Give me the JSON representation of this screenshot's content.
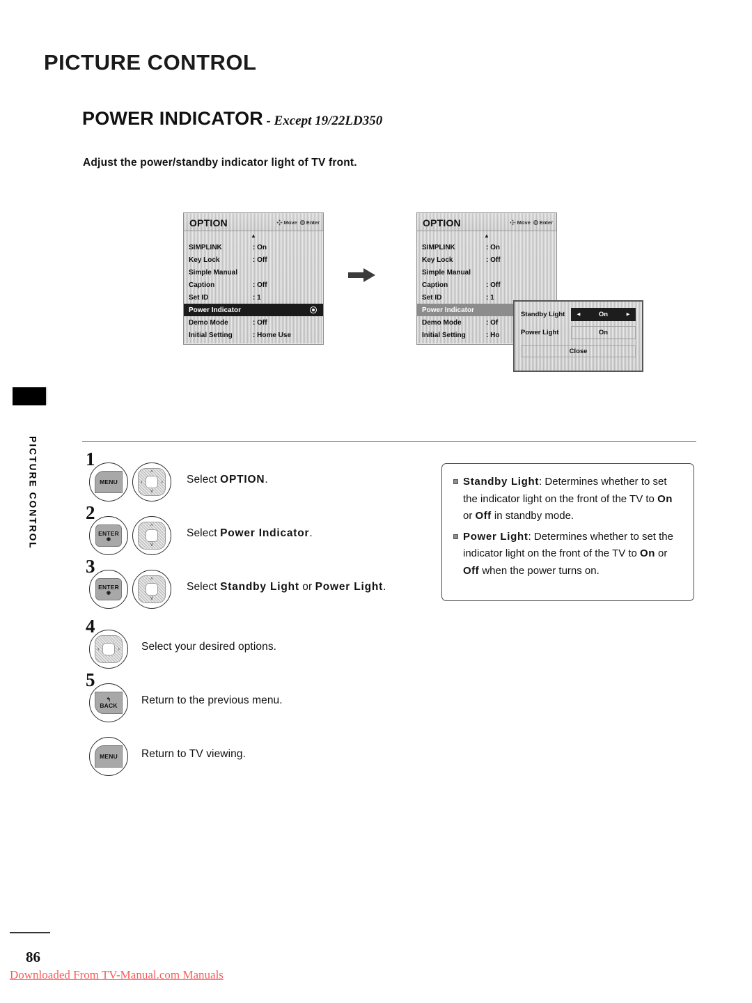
{
  "page": {
    "chapter_title": "PICTURE CONTROL",
    "section_title": "POWER INDICATOR",
    "section_subtitle": "- Except 19/22LD350",
    "lede": "Adjust the power/standby indicator light of TV front.",
    "side_tab_text": "PICTURE CONTROL",
    "page_number": "86",
    "download_note": "Downloaded From TV-Manual.com Manuals"
  },
  "osd": {
    "title": "OPTION",
    "hints": [
      {
        "icon": "dpad-move-icon",
        "label": "Move"
      },
      {
        "icon": "enter-dot-icon",
        "label": "Enter"
      }
    ],
    "scroll_up_glyph": "▲",
    "rows": [
      {
        "label": "SIMPLINK",
        "value": ": On"
      },
      {
        "label": "Key Lock",
        "value": ": Off"
      },
      {
        "label": "Simple Manual",
        "value": ""
      },
      {
        "label": "Caption",
        "value": ": Off"
      },
      {
        "label": "Set ID",
        "value": ": 1"
      },
      {
        "label": "Power Indicator",
        "value": ""
      },
      {
        "label": "Demo Mode",
        "value": ": Off"
      },
      {
        "label": "Initial Setting",
        "value": ": Home Use"
      }
    ],
    "rows_panel2": [
      {
        "label": "SIMPLINK",
        "value": ": On"
      },
      {
        "label": "Key Lock",
        "value": ": Off"
      },
      {
        "label": "Simple Manual",
        "value": ""
      },
      {
        "label": "Caption",
        "value": ": Off"
      },
      {
        "label": "Set ID",
        "value": ": 1"
      },
      {
        "label": "Power Indicator",
        "value": ""
      },
      {
        "label": "Demo Mode",
        "value": ": Of"
      },
      {
        "label": "Initial Setting",
        "value": ": Ho"
      }
    ],
    "selected_row_index": 5
  },
  "popup": {
    "standby_light_label": "Standby Light",
    "standby_light_value": "On",
    "arrow_left": "◄",
    "arrow_right": "►",
    "power_light_label": "Power Light",
    "power_light_value": "On",
    "close_label": "Close"
  },
  "steps": [
    {
      "num": "1",
      "buttons": [
        "MENU",
        "navpad-4way"
      ],
      "text_prefix": "Select ",
      "text_bold": "OPTION",
      "text_suffix": "."
    },
    {
      "num": "2",
      "buttons": [
        "ENTER",
        "navpad-updown"
      ],
      "text_prefix": "Select ",
      "text_bold": "Power Indicator",
      "text_suffix": "."
    },
    {
      "num": "3",
      "buttons": [
        "ENTER",
        "navpad-updown"
      ],
      "text_prefix": "Select ",
      "text_bold": "Standby Light",
      "text_mid": " or ",
      "text_bold2": "Power Light",
      "text_suffix": "."
    },
    {
      "num": "4",
      "buttons": [
        "navpad-leftright"
      ],
      "text_plain": "Select your desired options."
    },
    {
      "num": "5",
      "buttons": [
        "BACK"
      ],
      "text_plain": "Return to the previous menu."
    },
    {
      "num": "",
      "buttons": [
        "MENU"
      ],
      "text_plain": "Return to TV viewing."
    }
  ],
  "buttons": {
    "menu_label": "MENU",
    "enter_label": "ENTER",
    "enter_dot": "◉",
    "back_label": "BACK",
    "back_glyph": "↰"
  },
  "notes": [
    {
      "term": "Standby Light",
      "body_1": ": Determines whether to set the indicator light on the front of the TV to ",
      "on": "On",
      "or": " or ",
      "off": "Off",
      "body_2": " in standby mode."
    },
    {
      "term": "Power Light",
      "body_1": ": Determines whether to set the indicator light on the front of the TV to ",
      "on": "On",
      "or": " or ",
      "off": "Off",
      "body_2": " when the power turns on."
    }
  ],
  "colors": {
    "accent_red": "#fb5a5a",
    "osd_gray": "#c8c8c8",
    "osd_selected_dark": "#1b1b1b",
    "osd_selected_gray": "#8c8c8c"
  }
}
